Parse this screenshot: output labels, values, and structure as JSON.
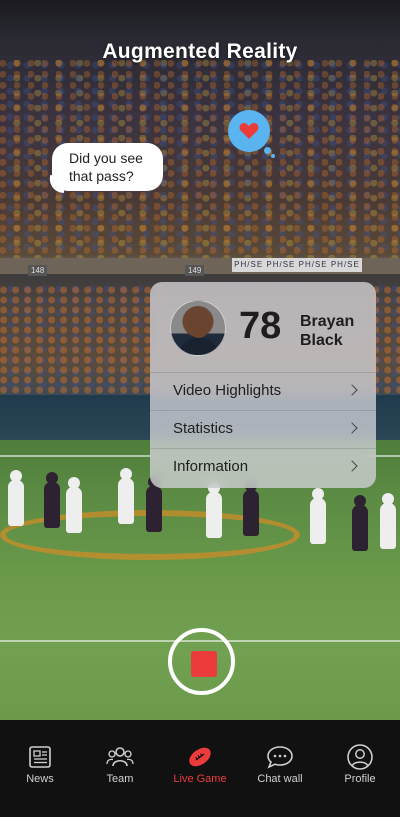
{
  "header": {
    "title": "Augmented Reality"
  },
  "chat_bubble": {
    "text": "Did you see that pass?"
  },
  "reaction": {
    "icon": "heart-icon",
    "color": "#5ab4f0"
  },
  "stadium": {
    "ad_board_text": "PH/SE PH/SE PH/SE PH/SE",
    "section_left": "148",
    "section_right": "149"
  },
  "player_card": {
    "number": "78",
    "first_name": "Brayan",
    "last_name": "Black",
    "menu": [
      {
        "label": "Video Highlights"
      },
      {
        "label": "Statistics"
      },
      {
        "label": "Information"
      }
    ]
  },
  "record_button": {
    "color": "#ec3b3b"
  },
  "tabbar": {
    "active_color": "#ec3b3b",
    "tabs": [
      {
        "label": "News",
        "icon": "newspaper-icon"
      },
      {
        "label": "Team",
        "icon": "team-icon"
      },
      {
        "label": "Live Game",
        "icon": "football-icon"
      },
      {
        "label": "Chat wall",
        "icon": "chat-icon"
      },
      {
        "label": "Profile",
        "icon": "profile-icon"
      }
    ]
  }
}
